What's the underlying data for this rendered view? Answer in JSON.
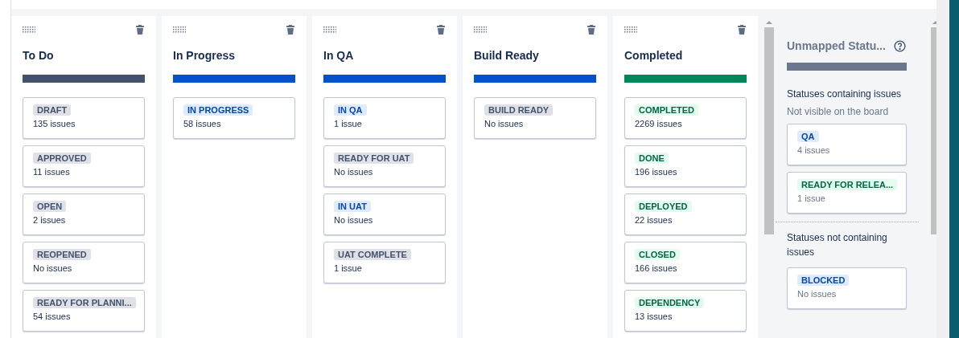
{
  "columns": [
    {
      "title": "To Do",
      "color": "#42526e",
      "statuses": [
        {
          "label": "DRAFT",
          "kind": "todo",
          "count": "135 issues"
        },
        {
          "label": "APPROVED",
          "kind": "todo",
          "count": "11 issues"
        },
        {
          "label": "OPEN",
          "kind": "todo",
          "count": "2 issues"
        },
        {
          "label": "REOPENED",
          "kind": "todo",
          "count": "No issues"
        },
        {
          "label": "READY FOR PLANNI...",
          "kind": "todo",
          "count": "54 issues"
        }
      ]
    },
    {
      "title": "In Progress",
      "color": "#0052cc",
      "statuses": [
        {
          "label": "IN PROGRESS",
          "kind": "inprogress",
          "count": "58 issues"
        }
      ]
    },
    {
      "title": "In QA",
      "color": "#0052cc",
      "statuses": [
        {
          "label": "IN QA",
          "kind": "inprogress",
          "count": "1 issue"
        },
        {
          "label": "READY FOR UAT",
          "kind": "todo",
          "count": "No issues"
        },
        {
          "label": "IN UAT",
          "kind": "inprogress",
          "count": "No issues"
        },
        {
          "label": "UAT COMPLETE",
          "kind": "todo",
          "count": "1 issue"
        }
      ]
    },
    {
      "title": "Build Ready",
      "color": "#0052cc",
      "statuses": [
        {
          "label": "BUILD READY",
          "kind": "todo",
          "count": "No issues"
        }
      ]
    },
    {
      "title": "Completed",
      "color": "#00875a",
      "statuses": [
        {
          "label": "COMPLETED",
          "kind": "done",
          "count": "2269 issues"
        },
        {
          "label": "DONE",
          "kind": "done",
          "count": "196 issues"
        },
        {
          "label": "DEPLOYED",
          "kind": "done",
          "count": "22 issues"
        },
        {
          "label": "CLOSED",
          "kind": "done",
          "count": "166 issues"
        },
        {
          "label": "DEPENDENCY",
          "kind": "done",
          "count": "13 issues"
        }
      ]
    }
  ],
  "unmapped": {
    "title": "Unmapped Statu...",
    "with_issues": {
      "heading": "Statuses containing issues",
      "note": "Not visible on the board",
      "statuses": [
        {
          "label": "QA",
          "kind": "inprogress",
          "count": "4 issues"
        },
        {
          "label": "READY FOR RELEA...",
          "kind": "done",
          "count": "1 issue"
        }
      ]
    },
    "without_issues": {
      "heading": "Statuses not containing issues",
      "statuses": [
        {
          "label": "BLOCKED",
          "kind": "inprogress",
          "count": "No issues"
        }
      ]
    }
  }
}
